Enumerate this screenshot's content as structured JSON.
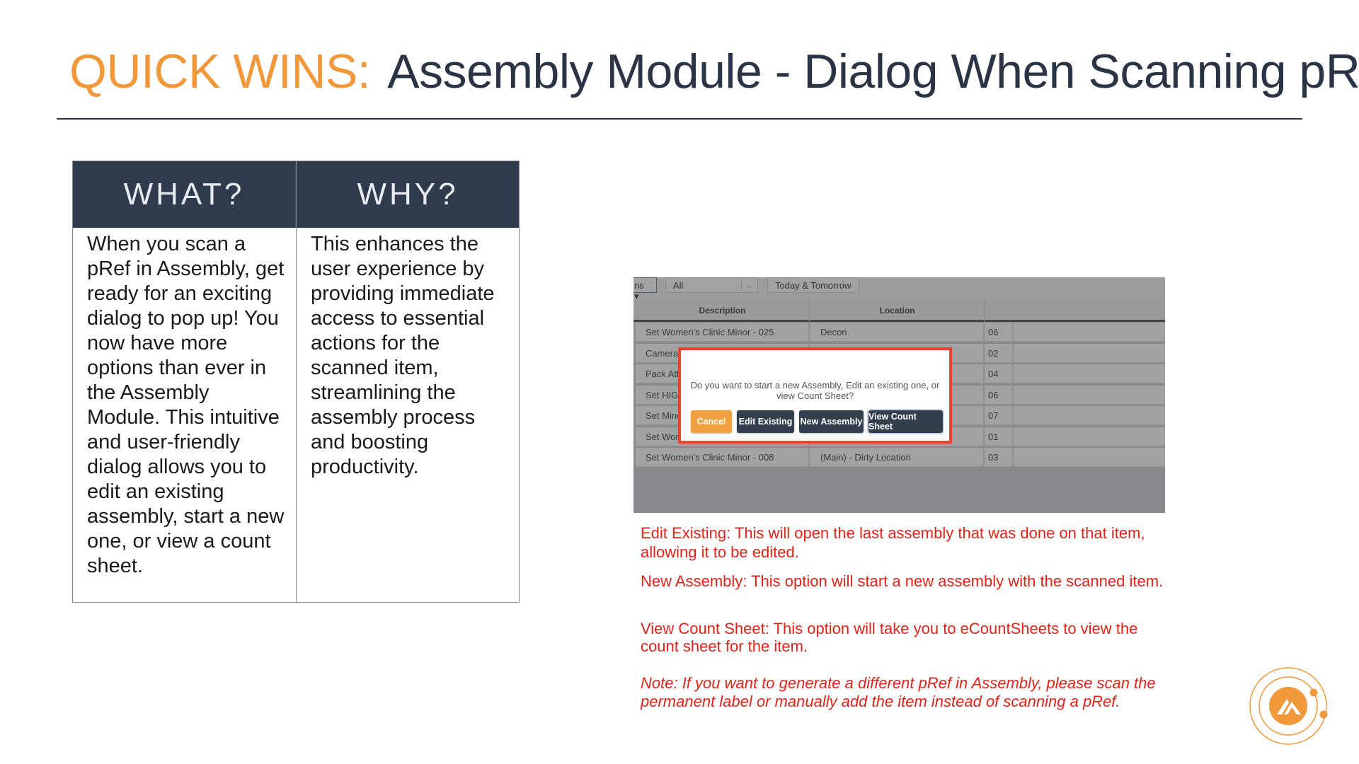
{
  "title": {
    "highlight": "QUICK WINS:",
    "text": "Assembly Module - Dialog When Scanning pRef"
  },
  "table": {
    "headers": [
      "WHAT?",
      "WHY?"
    ],
    "what": "When you scan a pRef in Assembly, get ready for an exciting dialog to pop up! You now have more options than ever in the Assembly Module. This intuitive and user-friendly dialog allows you to edit an existing assembly, start a new one, or view a count sheet.",
    "why": "This enhances the user experience by providing immediate access to essential actions for the scanned item, streamlining the assembly process and boosting productivity."
  },
  "screenshot": {
    "toolbar": {
      "button": "ns ▾",
      "filter1": "All",
      "filter2": "Today & Tomorrow"
    },
    "columns": [
      "Description",
      "Location"
    ],
    "rows": [
      [
        "Set Women's Clinic Minor - 025",
        "Decon",
        "06"
      ],
      [
        "Camera Stor",
        "",
        "02"
      ],
      [
        "Pack Atlantis",
        "",
        "04"
      ],
      [
        "Set HIGH PR",
        "",
        "06"
      ],
      [
        "Set Minor Su",
        "",
        "07"
      ],
      [
        "Set Women'",
        "",
        "01"
      ],
      [
        "Set Women's Clinic Minor - 008",
        "(Main) - Dirty Location",
        "03"
      ]
    ],
    "dialog": {
      "message": "Do you want to start a new Assembly, Edit an existing one, or view Count Sheet?",
      "buttons": [
        "Cancel",
        "Edit Existing",
        "New Assembly",
        "View Count Sheet"
      ]
    }
  },
  "notes": [
    "Edit Existing: This will open the last assembly that was done on that item, allowing it to be edited.",
    "New Assembly: This option will start a new assembly with the scanned item.",
    "View Count Sheet: This option will take you to eCountSheets to view the count sheet for the item.",
    "Note: If you want to generate a different pRef in Assembly, please scan the permanent label or manually add the item instead of scanning a pRef."
  ],
  "colors": {
    "accent": "#f0983a",
    "navy": "#2f3b4d",
    "note_red": "#e02419",
    "dialog_border": "#e8432c"
  }
}
